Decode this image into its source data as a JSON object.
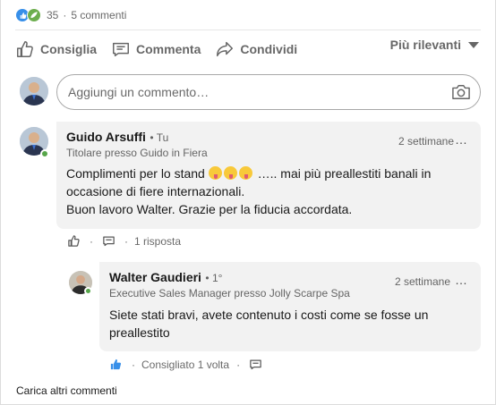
{
  "social": {
    "reaction_count": "35",
    "separator": "·",
    "comments_count": "5 commenti"
  },
  "actions": {
    "like": "Consiglia",
    "comment": "Commenta",
    "share": "Condividi"
  },
  "sort": {
    "label": "Più rilevanti"
  },
  "composer": {
    "placeholder": "Aggiungi un commento…"
  },
  "comments": [
    {
      "author": "Guido Arsuffi",
      "degree": "• Tu",
      "headline": "Titolare presso Guido in Fiera",
      "time": "2 settimane",
      "more": "…",
      "text_before_emoji": "Complimenti per lo stand",
      "text_after_emoji": "….. mai più preallestiti banali in occasione di fiere internazionali.",
      "text_line2": "Buon lavoro Walter. Grazie per la fiducia accordata.",
      "replies": "1 risposta",
      "separator": "·"
    },
    {
      "author": "Walter Gaudieri",
      "degree": "• 1°",
      "headline": "Executive Sales Manager presso Jolly Scarpe Spa",
      "time": "2 settimane",
      "more": "…",
      "text": "Siete stati bravi, avete contenuto i costi come se fosse un preallestito",
      "liked_label": "Consigliato 1 volta",
      "separator": "·"
    }
  ],
  "load_more": "Carica altri commenti",
  "colors": {
    "like_blue": "#378fe9",
    "support_green": "#6dae4f",
    "online_green": "#57a64a",
    "bubble_bg": "#f2f2f2"
  }
}
